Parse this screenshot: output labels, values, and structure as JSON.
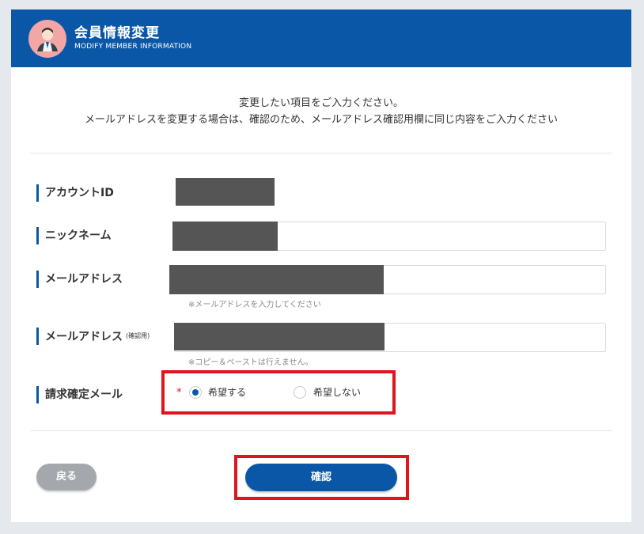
{
  "header": {
    "title_ja": "会員情報変更",
    "title_en": "MODIFY MEMBER INFORMATION",
    "color": "#0b57a7"
  },
  "intro": {
    "line1": "変更したい項目をご入力ください。",
    "line2": "メールアドレスを変更する場合は、確認のため、メールアドレス確認用欄に同じ内容をご入力ください"
  },
  "fields": {
    "account_id": {
      "label": "アカウントID"
    },
    "nickname": {
      "label": "ニックネーム"
    },
    "email": {
      "label": "メールアドレス",
      "note": "※メールアドレスを入力してください"
    },
    "email_confirm": {
      "label": "メールアドレス",
      "label_suffix": "(確認用)",
      "note": "※コピー＆ペーストは行えません。"
    },
    "billing_mail": {
      "label": "請求確定メール",
      "required_mark": "*",
      "options": [
        {
          "label": "希望する",
          "checked": true
        },
        {
          "label": "希望しない",
          "checked": false
        }
      ]
    }
  },
  "buttons": {
    "back": "戻る",
    "confirm": "確認"
  },
  "colors": {
    "accent": "#0b57a7",
    "highlight": "#e0141e",
    "back_button": "#a4a8ac"
  }
}
